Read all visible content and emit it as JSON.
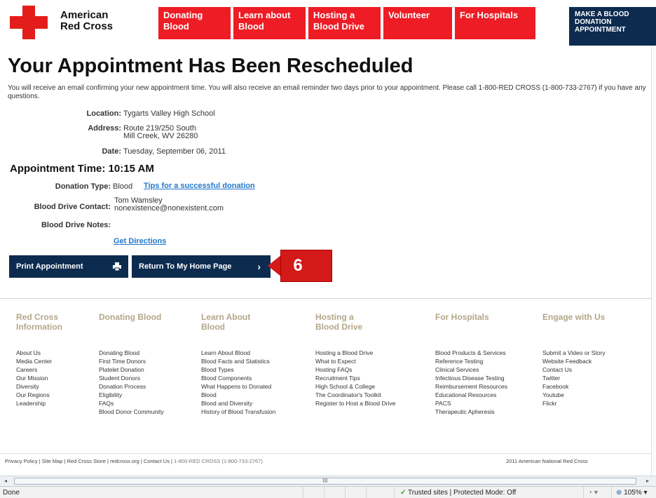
{
  "header": {
    "logo_line1": "American",
    "logo_line2": "Red Cross",
    "nav": [
      {
        "line1": "Donating",
        "line2": "Blood"
      },
      {
        "line1": "Learn about",
        "line2": "Blood"
      },
      {
        "line1": "Hosting a",
        "line2": "Blood Drive"
      },
      {
        "line1": "Volunteer",
        "line2": ""
      },
      {
        "line1": "For Hospitals",
        "line2": ""
      }
    ],
    "cta_lines": [
      "MAKE A BLOOD",
      "DONATION",
      "APPOINTMENT"
    ]
  },
  "main": {
    "title": "Your Appointment Has Been Rescheduled",
    "intro": "You will receive an email confirming your new appointment time. You will also receive an email reminder two days prior to your appointment. Please call 1-800-RED CROSS (1-800-733-2767) if you have any questions.",
    "location_label": "Location:",
    "location_value": "Tygarts Valley High School",
    "address_label": "Address:",
    "address_line1": "Route 219/250 South",
    "address_line2": "Mill Creek, WV 26280",
    "date_label": "Date:",
    "date_value": "Tuesday, September 06, 2011",
    "appt_time": "Appointment Time: 10:15 AM",
    "donation_type_label": "Donation Type:",
    "donation_type_value": "Blood",
    "tips_link": "Tips for a successful donation",
    "contact_label": "Blood Drive Contact:",
    "contact_name": "Tom Wamsley",
    "contact_email": "nonexistence@nonexistent.com",
    "notes_label": "Blood Drive Notes:",
    "directions_link": "Get Directions",
    "print_button": "Print Appointment",
    "home_button": "Return To My Home Page",
    "callout_number": "6"
  },
  "footer": {
    "columns": [
      {
        "heading": [
          "Red Cross",
          "Information"
        ],
        "links": [
          "About Us",
          "Media Center",
          "Careers",
          "Our Mission",
          "Diversity",
          "Our Regions",
          "Leadership"
        ]
      },
      {
        "heading": [
          "Donating Blood"
        ],
        "links": [
          "Donating Blood",
          "First Time Donors",
          "Platelet Donation",
          "Student Donors",
          "Donation Process",
          "Eligibility",
          "FAQs",
          "Blood Donor Community"
        ]
      },
      {
        "heading": [
          "Learn About",
          "Blood"
        ],
        "links": [
          "Learn About Blood",
          "Blood Facts and Statistics",
          "Blood Types",
          "Blood Components",
          "What Happens to Donated",
          "Blood",
          "Blood and Diversity",
          "History of Blood Transfusion"
        ]
      },
      {
        "heading": [
          "Hosting a",
          "Blood Drive"
        ],
        "links": [
          "Hosting a Blood Drive",
          "What to Expect",
          "Hosting FAQs",
          "Recruitment Tips",
          "High School & College",
          "The Coordinator's Toolkit",
          "Register to Host a Blood Drive"
        ]
      },
      {
        "heading": [
          "For Hospitals"
        ],
        "links": [
          "Blood Products & Services",
          "Reference Testing",
          "Clinical Services",
          "Infectious Disease Testing",
          "Reimbursement Resources",
          "Educational Resources",
          "PACS",
          "Therapeutic Apheresis"
        ]
      },
      {
        "heading": [
          "Engage with Us"
        ],
        "links": [
          "Submit a Video or Story",
          "Website Feedback",
          "Contact Us",
          "Twitter",
          "Facebook",
          "Youtube",
          "Flickr"
        ]
      }
    ],
    "legal_links": "Privacy Policy | Site Map | Red Cross Store | redcross.org | Contact Us |",
    "phone": "1-800-RED CROSS (1-800-733-2767)",
    "copyright": "2011 American National Red Cross"
  },
  "browser": {
    "status": "Done",
    "zone": "Trusted sites | Protected Mode: Off",
    "zoom": "105%",
    "scroll_marker": "III"
  }
}
